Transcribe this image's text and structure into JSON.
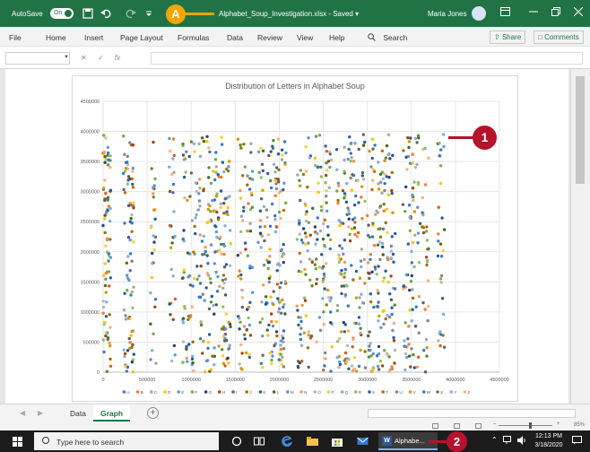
{
  "titlebar": {
    "autosave_label": "AutoSave",
    "autosave_state": "On",
    "callout": "A",
    "doc_title": "Alphabet_Soup_Investigation.xlsx  -  Saved  ▾",
    "user_name": "Maria Jones",
    "icons": [
      "save-icon",
      "undo-icon",
      "redo-icon",
      "customize-icon"
    ]
  },
  "menu": {
    "items": [
      "File",
      "Home",
      "Insert",
      "Page Layout",
      "Formulas",
      "Data",
      "Review",
      "View",
      "Help"
    ],
    "search_label": "Search",
    "share_label": "Share",
    "comments_label": "Comments"
  },
  "formula_bar": {
    "name_box_value": "",
    "fx_label": "fx",
    "formula_value": ""
  },
  "chart_data": {
    "type": "scatter",
    "title": "Distribution of Letters in Alphabet Soup",
    "xlabel": "",
    "ylabel": "",
    "xlim": [
      0,
      4500000
    ],
    "ylim": [
      0,
      4500000
    ],
    "x_ticks": [
      "0",
      "500000",
      "1000000",
      "1500000",
      "2000000",
      "2500000",
      "3000000",
      "3500000",
      "4000000",
      "4500000"
    ],
    "y_ticks": [
      "0",
      "500000",
      "1000000",
      "1500000",
      "2000000",
      "2500000",
      "3000000",
      "3500000",
      "4000000",
      "4500000"
    ],
    "grid": true,
    "legend_position": "bottom",
    "series": [
      {
        "name": "A",
        "color": "#4472c4"
      },
      {
        "name": "B",
        "color": "#ed7d31"
      },
      {
        "name": "C",
        "color": "#a5a5a5"
      },
      {
        "name": "D",
        "color": "#ffc000"
      },
      {
        "name": "E",
        "color": "#5b9bd5"
      },
      {
        "name": "F",
        "color": "#70ad47"
      },
      {
        "name": "G",
        "color": "#264478"
      },
      {
        "name": "H",
        "color": "#9e480e"
      },
      {
        "name": "I",
        "color": "#636363"
      },
      {
        "name": "J",
        "color": "#997300"
      },
      {
        "name": "K",
        "color": "#255e91"
      },
      {
        "name": "L",
        "color": "#43682b"
      },
      {
        "name": "M",
        "color": "#698ed0"
      },
      {
        "name": "N",
        "color": "#f1975a"
      },
      {
        "name": "O",
        "color": "#b7b7b7"
      },
      {
        "name": "P",
        "color": "#ffcd33"
      },
      {
        "name": "Q",
        "color": "#7cafdd"
      },
      {
        "name": "R",
        "color": "#8cc168"
      },
      {
        "name": "S",
        "color": "#335aa1"
      },
      {
        "name": "T",
        "color": "#d26012"
      },
      {
        "name": "U",
        "color": "#848484"
      },
      {
        "name": "V",
        "color": "#cc9a00"
      },
      {
        "name": "W",
        "color": "#327dc2"
      },
      {
        "name": "X",
        "color": "#5a8a39"
      },
      {
        "name": "Y",
        "color": "#8faadc"
      },
      {
        "name": "Z",
        "color": "#f4b183"
      }
    ],
    "x_band_ranges": [
      [
        0,
        90000
      ],
      [
        230000,
        350000
      ],
      [
        530000,
        600000
      ],
      [
        750000,
        820000
      ],
      [
        900000,
        1450000
      ],
      [
        1530000,
        1700000
      ],
      [
        1760000,
        2080000
      ],
      [
        2200000,
        2380000
      ],
      [
        2400000,
        2600000
      ],
      [
        2650000,
        2980000
      ],
      [
        3000000,
        3320000
      ],
      [
        3400000,
        3600000
      ],
      [
        3620000,
        3700000
      ],
      [
        3800000,
        3880000
      ]
    ],
    "y_max_of_points": 3950000,
    "points_per_band": [
      80,
      80,
      30,
      30,
      240,
      70,
      150,
      70,
      80,
      150,
      150,
      80,
      30,
      30
    ],
    "random_seed": 7
  },
  "callout_1": "1",
  "sheet_tabs": {
    "tabs": [
      "Data",
      "Graph"
    ],
    "active": "Graph",
    "add_label": "+"
  },
  "statusbar": {
    "zoom_minus": "–",
    "zoom_plus": "+",
    "zoom_level": "85%"
  },
  "taskbar": {
    "search_placeholder": "Type here to search",
    "app_label": "Alphabe...",
    "callout": "2",
    "time": "12:13 PM",
    "date": "3/18/2020"
  },
  "colors": {
    "excel_green": "#217346",
    "callout_red": "#b5122c",
    "callout_orange": "#f5a400"
  }
}
